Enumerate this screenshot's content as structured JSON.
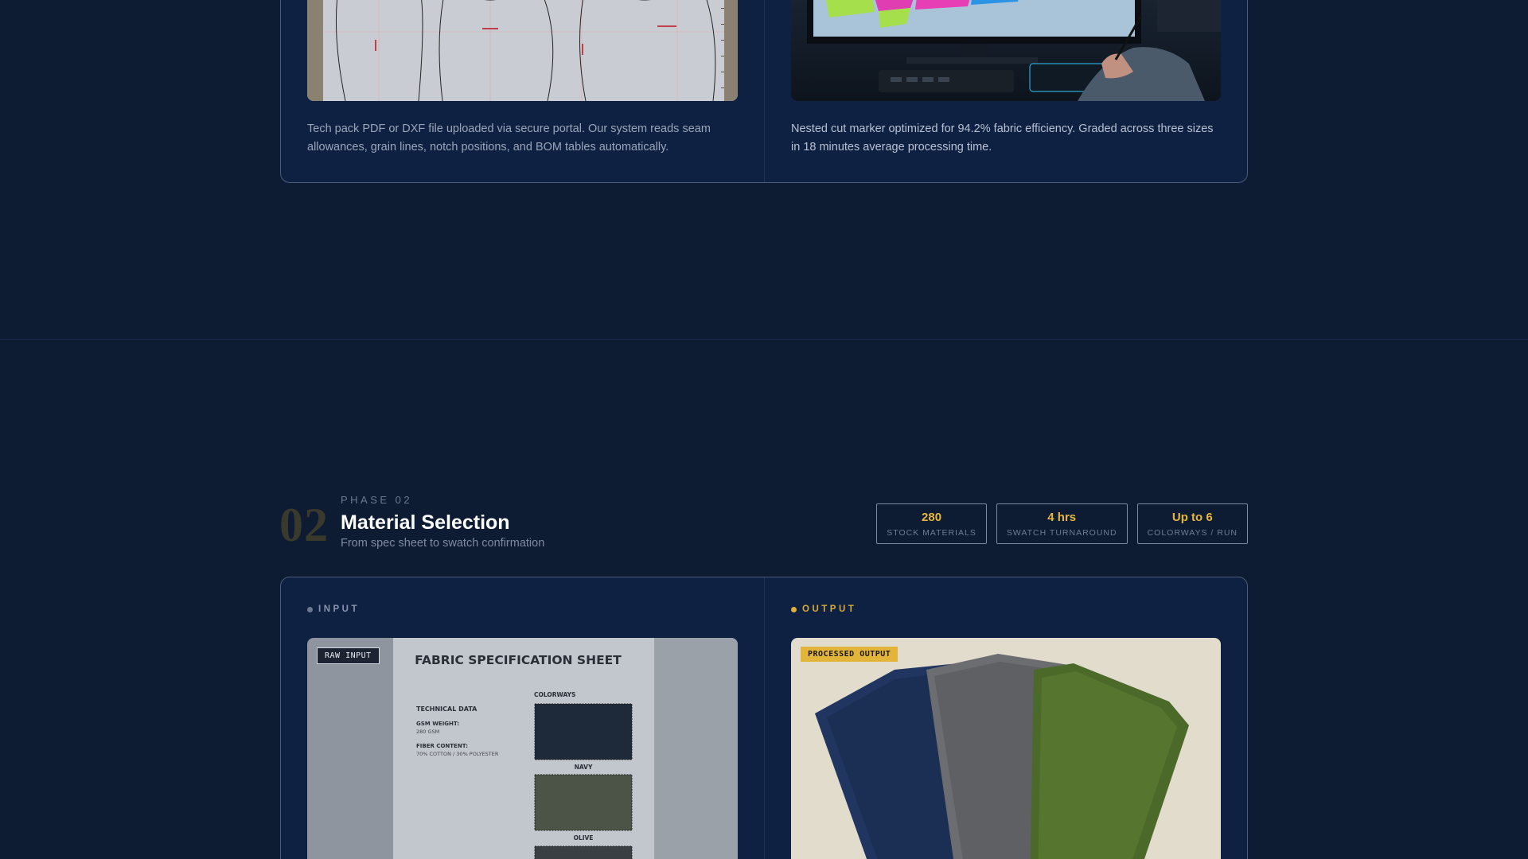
{
  "phase01": {
    "input_description": "Tech pack PDF or DXF file uploaded via secure portal. Our system reads seam allowances, grain lines, notch positions, and BOM tables automatically.",
    "output_description": "Nested cut marker optimized for 94.2% fabric efficiency. Graded across three sizes in 18 minutes average processing time."
  },
  "phase02": {
    "number": "02",
    "label": "PHASE 02",
    "title": "Material Selection",
    "subtitle": "From spec sheet to swatch confirmation",
    "stats": [
      {
        "value": "280",
        "label": "STOCK MATERIALS"
      },
      {
        "value": "4 hrs",
        "label": "SWATCH TURNAROUND"
      },
      {
        "value": "Up to 6",
        "label": "COLORWAYS / RUN"
      }
    ],
    "input": {
      "tag": "INPUT",
      "badge": "RAW INPUT",
      "sheet": {
        "title": "FABRIC SPECIFICATION SHEET",
        "technical_heading": "TECHNICAL DATA",
        "gsm_label": "GSM WEIGHT:",
        "gsm_value": "280 GSM",
        "fiber_label": "FIBER CONTENT:",
        "fiber_value": "70% COTTON / 30% POLYESTER",
        "colorways_heading": "COLORWAYS",
        "swatches": [
          {
            "name": "NAVY",
            "color": "#1e2a3a"
          },
          {
            "name": "OLIVE",
            "color": "#4c5448"
          }
        ]
      }
    },
    "output": {
      "tag": "OUTPUT",
      "badge": "PROCESSED OUTPUT"
    }
  },
  "colors": {
    "background": "#0d1b33",
    "card": "#0f2142",
    "accent": "#e3b43a"
  }
}
